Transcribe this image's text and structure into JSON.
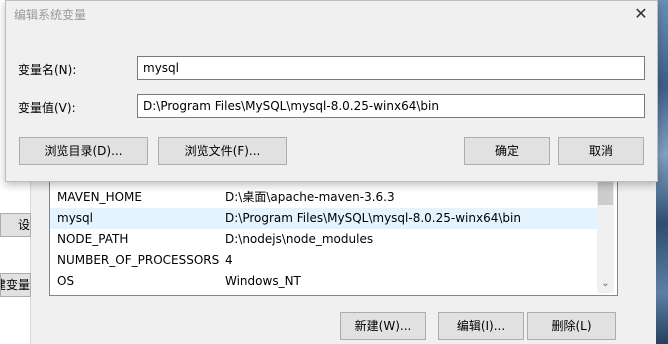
{
  "background": {
    "side_button_1": "设",
    "side_button_2": "建变量",
    "list_rows": [
      {
        "name": "MAVEN_HOME",
        "value": "D:\\桌面\\apache-maven-3.6.3"
      },
      {
        "name": "mysql",
        "value": "D:\\Program Files\\MySQL\\mysql-8.0.25-winx64\\bin"
      },
      {
        "name": "NODE_PATH",
        "value": "D:\\nodejs\\node_modules"
      },
      {
        "name": "NUMBER_OF_PROCESSORS",
        "value": "4"
      },
      {
        "name": "OS",
        "value": "Windows_NT"
      }
    ],
    "buttons": {
      "new": "新建(W)...",
      "edit": "编辑(I)...",
      "delete": "删除(L)"
    },
    "colors": {
      "selected_row": "#e5f3ff"
    }
  },
  "dialog": {
    "title": "编辑系统变量",
    "close_icon": "close-icon",
    "name_label": "变量名(N):",
    "name_value": "mysql",
    "value_label": "变量值(V):",
    "value_value": "D:\\Program Files\\MySQL\\mysql-8.0.25-winx64\\bin",
    "buttons": {
      "browse_dir": "浏览目录(D)...",
      "browse_file": "浏览文件(F)...",
      "ok": "确定",
      "cancel": "取消"
    }
  }
}
